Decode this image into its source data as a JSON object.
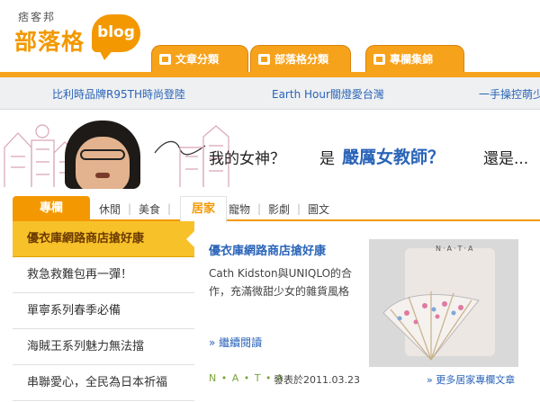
{
  "logo": {
    "small": "痞客邦",
    "big": "部落格",
    "bubble": "blog"
  },
  "nav": {
    "tabs": [
      {
        "label": "文章分類"
      },
      {
        "label": "部落格分類"
      },
      {
        "label": "專欄集錦"
      }
    ]
  },
  "ticker": {
    "items": [
      "比利時品牌R95TH時尚登陸",
      "Earth Hour關燈愛台灣",
      "一手操控萌少"
    ]
  },
  "banner": {
    "question": "我的女神？",
    "is": "是",
    "emphasis": "嚴厲女教師？",
    "still": "還是..."
  },
  "categories": {
    "main": "專欄",
    "items": [
      "休閒",
      "美食"
    ],
    "active": "居家",
    "rest": [
      "寵物",
      "影劇",
      "圖文"
    ]
  },
  "sidebar": {
    "items": [
      {
        "label": "優衣庫網路商店搶好康"
      },
      {
        "label": "救急救難包再一彈！"
      },
      {
        "label": "單寧系列春季必備"
      },
      {
        "label": "海賊王系列魅力無法擋"
      },
      {
        "label": "串聯愛心，全民為日本祈福"
      }
    ]
  },
  "article": {
    "title": "優衣庫網路商店搶好康",
    "summary": "Cath Kidston與UNIQLO的合作，充滿微甜少女的雜貨風格",
    "more": "» 繼續閱讀",
    "image_brand": "N·A·T·A",
    "author": "N • A • T • A",
    "date": "發表於2011.03.23",
    "more_column": "» 更多居家專欄文章"
  }
}
